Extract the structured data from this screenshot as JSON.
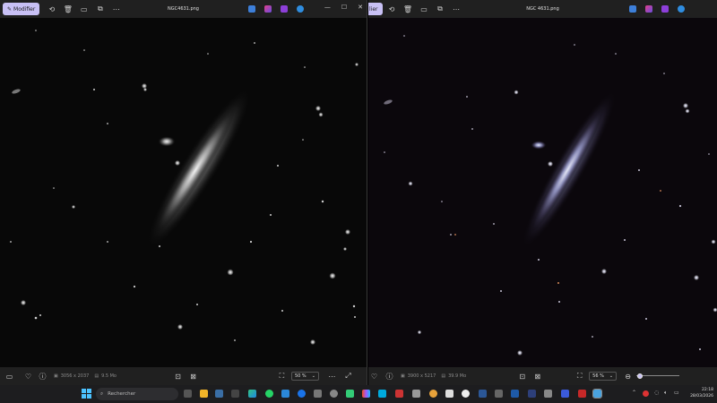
{
  "left_window": {
    "edit_label": "Modifier",
    "title": "NGC4631.png",
    "dimensions": "3056 x 2037",
    "size": "9.5 Mo",
    "zoom": "50 %"
  },
  "right_window": {
    "edit_label": "lier",
    "title": "NGC 4631.png",
    "dimensions": "3900 x 5217",
    "size": "39.9 Mo",
    "zoom": "56 %",
    "zoom_slider_level": 0.03
  },
  "taskbar": {
    "search_placeholder": "Rechercher",
    "time": "22:18",
    "date": "28/03/2026"
  },
  "colors": {
    "accent": "#c8c0f5",
    "titlebar": "#202020",
    "taskbar": "#1d1d1f"
  },
  "icons": {
    "toolbar": [
      "rotate-icon",
      "delete-icon",
      "print-icon",
      "crop-icon",
      "more-icon"
    ],
    "apps": [
      "designer-icon",
      "copilot-icon",
      "clipchamp-icon",
      "onedrive-icon"
    ]
  }
}
